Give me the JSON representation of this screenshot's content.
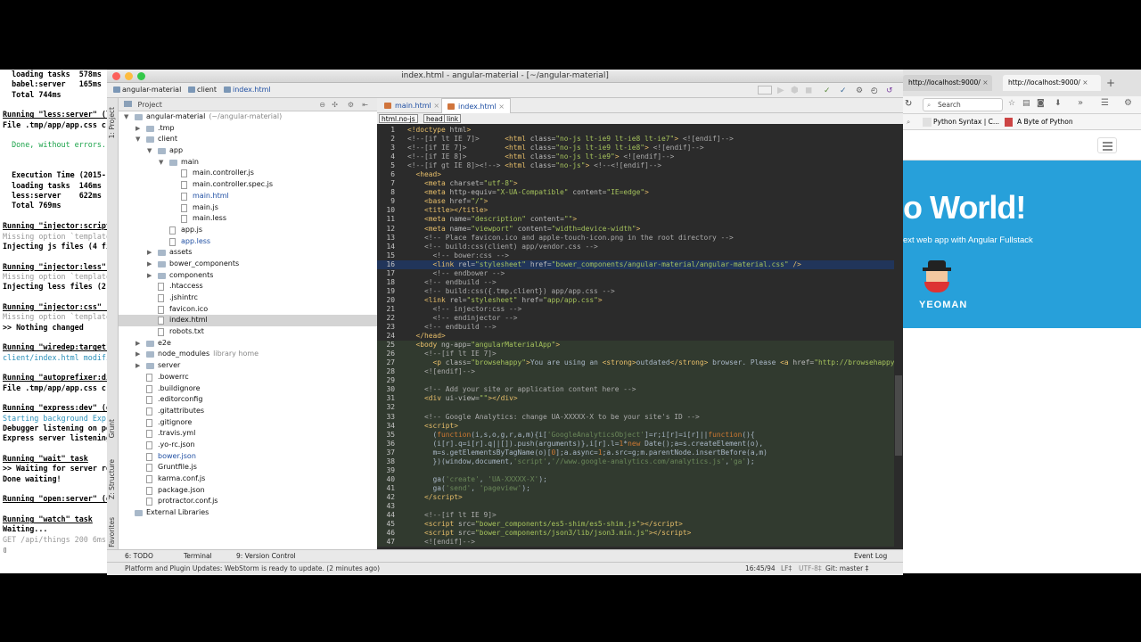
{
  "terminal": {
    "lines": [
      {
        "t": "  loading tasks  578ms",
        "c": "t-b"
      },
      {
        "t": "  babel:server   165ms",
        "c": "t-b"
      },
      {
        "t": "  Total 744ms",
        "c": "t-b"
      },
      {
        "t": "",
        "c": ""
      },
      {
        "t": "Running \"less:server\" (less) task",
        "c": "t-u"
      },
      {
        "t": "File .tmp/app/app.css created.",
        "c": "t-b"
      },
      {
        "t": "",
        "c": ""
      },
      {
        "t": "  Done, without errors.",
        "c": "t-g"
      },
      {
        "t": "",
        "c": ""
      },
      {
        "t": "",
        "c": ""
      },
      {
        "t": "  Execution Time (2015-",
        "c": "t-b"
      },
      {
        "t": "  loading tasks  146ms",
        "c": "t-b"
      },
      {
        "t": "  less:server    622ms",
        "c": "t-b"
      },
      {
        "t": "  Total 769ms",
        "c": "t-b"
      },
      {
        "t": "",
        "c": ""
      },
      {
        "t": "Running \"injector:scripts\"",
        "c": "t-u"
      },
      {
        "t": "Missing option `template`",
        "c": "t-gr"
      },
      {
        "t": "Injecting js files (4 fil",
        "c": "t-b"
      },
      {
        "t": "",
        "c": ""
      },
      {
        "t": "Running \"injector:less\" (",
        "c": "t-u"
      },
      {
        "t": "Missing option `template`",
        "c": "t-gr"
      },
      {
        "t": "Injecting less files (2 f",
        "c": "t-b"
      },
      {
        "t": "",
        "c": ""
      },
      {
        "t": "Running \"injector:css\" (i",
        "c": "t-u"
      },
      {
        "t": "Missing option `template`",
        "c": "t-gr"
      },
      {
        "t": ">> Nothing changed",
        "c": "t-b"
      },
      {
        "t": "",
        "c": ""
      },
      {
        "t": "Running \"wiredep:target\" (",
        "c": "t-u"
      },
      {
        "t": "client/index.html modified",
        "c": "t-c"
      },
      {
        "t": "",
        "c": ""
      },
      {
        "t": "Running \"autoprefixer:dist",
        "c": "t-u"
      },
      {
        "t": "File .tmp/app/app.css crea",
        "c": "t-b"
      },
      {
        "t": "",
        "c": ""
      },
      {
        "t": "Running \"express:dev\" (ex",
        "c": "t-u"
      },
      {
        "t": "Starting background Expres",
        "c": "t-c"
      },
      {
        "t": "Debugger listening on port",
        "c": "t-b"
      },
      {
        "t": "Express server listening o",
        "c": "t-b"
      },
      {
        "t": "",
        "c": ""
      },
      {
        "t": "Running \"wait\" task",
        "c": "t-u"
      },
      {
        "t": ">> Waiting for server rel",
        "c": "t-b"
      },
      {
        "t": "Done waiting!",
        "c": "t-b"
      },
      {
        "t": "",
        "c": ""
      },
      {
        "t": "Running \"open:server\" (op",
        "c": "t-u"
      },
      {
        "t": "",
        "c": ""
      },
      {
        "t": "Running \"watch\" task",
        "c": "t-u"
      },
      {
        "t": "Waiting...",
        "c": "t-b"
      },
      {
        "t": "GET /api/things 200 6ms -",
        "c": "t-gr"
      },
      {
        "t": "▯",
        "c": ""
      }
    ]
  },
  "ide": {
    "title": "index.html - angular-material - [~/angular-material]",
    "breadcrumb": [
      "angular-material",
      "client",
      "index.html"
    ],
    "project_label": "Project",
    "side_labels": {
      "project": "1: Project",
      "grunt": "Grunt",
      "structure": "Z: Structure",
      "favorites": "2: Favorites"
    },
    "tree": [
      {
        "name": "angular-material",
        "extra": "(~/angular-material)",
        "d": 0,
        "k": "folder",
        "open": true
      },
      {
        "name": ".tmp",
        "d": 1,
        "k": "folder",
        "open": false
      },
      {
        "name": "client",
        "d": 1,
        "k": "folder",
        "open": true
      },
      {
        "name": "app",
        "d": 2,
        "k": "folder",
        "open": true
      },
      {
        "name": "main",
        "d": 3,
        "k": "folder",
        "open": true
      },
      {
        "name": "main.controller.js",
        "d": 4,
        "k": "file"
      },
      {
        "name": "main.controller.spec.js",
        "d": 4,
        "k": "file"
      },
      {
        "name": "main.html",
        "d": 4,
        "k": "file",
        "blue": true
      },
      {
        "name": "main.js",
        "d": 4,
        "k": "file"
      },
      {
        "name": "main.less",
        "d": 4,
        "k": "file"
      },
      {
        "name": "app.js",
        "d": 3,
        "k": "file"
      },
      {
        "name": "app.less",
        "d": 3,
        "k": "file",
        "blue": true
      },
      {
        "name": "assets",
        "d": 2,
        "k": "folder",
        "closed": true
      },
      {
        "name": "bower_components",
        "d": 2,
        "k": "folder",
        "closed": true
      },
      {
        "name": "components",
        "d": 2,
        "k": "folder",
        "closed": true
      },
      {
        "name": ".htaccess",
        "d": 2,
        "k": "file"
      },
      {
        "name": ".jshintrc",
        "d": 2,
        "k": "file"
      },
      {
        "name": "favicon.ico",
        "d": 2,
        "k": "file"
      },
      {
        "name": "index.html",
        "d": 2,
        "k": "file",
        "sel": true
      },
      {
        "name": "robots.txt",
        "d": 2,
        "k": "file"
      },
      {
        "name": "e2e",
        "d": 1,
        "k": "folder",
        "closed": true
      },
      {
        "name": "node_modules",
        "extra": "library home",
        "d": 1,
        "k": "folder",
        "closed": true
      },
      {
        "name": "server",
        "d": 1,
        "k": "folder",
        "closed": true
      },
      {
        "name": ".bowerrc",
        "d": 1,
        "k": "file"
      },
      {
        "name": ".buildignore",
        "d": 1,
        "k": "file"
      },
      {
        "name": ".editorconfig",
        "d": 1,
        "k": "file"
      },
      {
        "name": ".gitattributes",
        "d": 1,
        "k": "file"
      },
      {
        "name": ".gitignore",
        "d": 1,
        "k": "file"
      },
      {
        "name": ".travis.yml",
        "d": 1,
        "k": "file"
      },
      {
        "name": ".yo-rc.json",
        "d": 1,
        "k": "file"
      },
      {
        "name": "bower.json",
        "d": 1,
        "k": "file",
        "blue": true
      },
      {
        "name": "Gruntfile.js",
        "d": 1,
        "k": "file"
      },
      {
        "name": "karma.conf.js",
        "d": 1,
        "k": "file"
      },
      {
        "name": "package.json",
        "d": 1,
        "k": "file"
      },
      {
        "name": "protractor.conf.js",
        "d": 1,
        "k": "file"
      },
      {
        "name": "External Libraries",
        "d": 0,
        "k": "lib"
      }
    ],
    "tabs": [
      {
        "label": "main.html",
        "active": false
      },
      {
        "label": "index.html",
        "active": true
      }
    ],
    "editor_crumbs": [
      "html.no-js",
      "head",
      "link"
    ],
    "code": [
      {
        "n": 1,
        "h": "<span class='tg'>&lt;!doctype </span><span class='at'>html</span><span class='tg'>&gt;</span>"
      },
      {
        "n": 2,
        "h": "<span class='cm'>&lt;!--[if lt IE 7]&gt;      </span><span class='tg'>&lt;html </span><span class='at'>class=</span><span class='av'>\"no-js lt-ie9 lt-ie8 lt-ie7\"</span><span class='tg'>&gt;</span><span class='cm'> &lt;![endif]--&gt;</span>"
      },
      {
        "n": 3,
        "h": "<span class='cm'>&lt;!--[if IE 7]&gt;         </span><span class='tg'>&lt;html </span><span class='at'>class=</span><span class='av'>\"no-js lt-ie9 lt-ie8\"</span><span class='tg'>&gt;</span><span class='cm'> &lt;![endif]--&gt;</span>"
      },
      {
        "n": 4,
        "h": "<span class='cm'>&lt;!--[if IE 8]&gt;         </span><span class='tg'>&lt;html </span><span class='at'>class=</span><span class='av'>\"no-js lt-ie9\"</span><span class='tg'>&gt;</span><span class='cm'> &lt;![endif]--&gt;</span>"
      },
      {
        "n": 5,
        "h": "<span class='cm'>&lt;!--[if gt IE 8]&gt;&lt;!--&gt; </span><span class='tg'>&lt;html </span><span class='at'>class=</span><span class='av'>\"no-js\"</span><span class='tg'>&gt;</span><span class='cm'> &lt;!--&lt;![endif]--&gt;</span>"
      },
      {
        "n": 6,
        "h": "  <span class='tg'>&lt;head&gt;</span>"
      },
      {
        "n": 7,
        "h": "    <span class='tg'>&lt;meta </span><span class='at'>charset=</span><span class='av'>\"utf-8\"</span><span class='tg'>&gt;</span>"
      },
      {
        "n": 8,
        "h": "    <span class='tg'>&lt;meta </span><span class='at'>http-equiv=</span><span class='av'>\"X-UA-Compatible\"</span><span class='at'> content=</span><span class='av'>\"IE=edge\"</span><span class='tg'>&gt;</span>"
      },
      {
        "n": 9,
        "h": "    <span class='tg'>&lt;base </span><span class='at'>href=</span><span class='av'>\"/\"</span><span class='tg'>&gt;</span>"
      },
      {
        "n": 10,
        "h": "    <span class='tg'>&lt;title&gt;&lt;/title&gt;</span>"
      },
      {
        "n": 11,
        "h": "    <span class='tg'>&lt;meta </span><span class='at'>name=</span><span class='av'>\"description\"</span><span class='at'> content=</span><span class='av'>\"\"</span><span class='tg'>&gt;</span>"
      },
      {
        "n": 12,
        "h": "    <span class='tg'>&lt;meta </span><span class='at'>name=</span><span class='av'>\"viewport\"</span><span class='at'> content=</span><span class='av'>\"width=device-width\"</span><span class='tg'>&gt;</span>"
      },
      {
        "n": 13,
        "h": "    <span class='cm'>&lt;!-- Place favicon.ico and apple-touch-icon.png in the root directory --&gt;</span>"
      },
      {
        "n": 14,
        "h": "    <span class='cm'>&lt;!-- build:css(client) app/vendor.css --&gt;</span>"
      },
      {
        "n": 15,
        "h": "      <span class='cm'>&lt;!-- bower:css --&gt;</span>"
      },
      {
        "n": 16,
        "h": "      <span class='tg'>&lt;link </span><span class='at'>rel=</span><span class='av'>\"stylesheet\"</span><span class='at'> href=</span><span class='av'>\"bower_components/angular-material/angular-material.css\"</span><span class='tg'> /&gt;</span>",
        "hl": true
      },
      {
        "n": 17,
        "h": "      <span class='cm'>&lt;!-- endbower --&gt;</span>"
      },
      {
        "n": 18,
        "h": "    <span class='cm'>&lt;!-- endbuild --&gt;</span>"
      },
      {
        "n": 19,
        "h": "    <span class='cm'>&lt;!-- build:css({.tmp,client}) app/app.css --&gt;</span>"
      },
      {
        "n": 20,
        "h": "    <span class='tg'>&lt;link </span><span class='at'>rel=</span><span class='av'>\"stylesheet\"</span><span class='at'> href=</span><span class='av'>\"app/app.css\"</span><span class='tg'>&gt;</span>"
      },
      {
        "n": 21,
        "h": "      <span class='cm'>&lt;!-- injector:css --&gt;</span>"
      },
      {
        "n": 22,
        "h": "      <span class='cm'>&lt;!-- endinjector --&gt;</span>"
      },
      {
        "n": 23,
        "h": "    <span class='cm'>&lt;!-- endbuild --&gt;</span>"
      },
      {
        "n": 24,
        "h": "  <span class='tg'>&lt;/head&gt;</span>"
      },
      {
        "n": 25,
        "h": "  <span class='tg'>&lt;body </span><span class='at'>ng-app=</span><span class='av'>\"angularMaterialApp\"</span><span class='tg'>&gt;</span>",
        "jsb": true
      },
      {
        "n": 26,
        "h": "    <span class='cm'>&lt;!--[if lt IE 7]&gt;</span>",
        "jsb": true
      },
      {
        "n": 27,
        "h": "      <span class='tg'>&lt;p </span><span class='at'>class=</span><span class='av'>\"browsehappy\"</span><span class='tg'>&gt;</span>You are using an <span class='tg'>&lt;strong&gt;</span>outdated<span class='tg'>&lt;/strong&gt;</span> browser. Please <span class='tg'>&lt;a </span><span class='at'>href=</span><span class='av'>\"http://browsehappy.com</span>",
        "jsb": true
      },
      {
        "n": 28,
        "h": "    <span class='cm'>&lt;![endif]--&gt;</span>",
        "jsb": true
      },
      {
        "n": 29,
        "h": "",
        "jsb": true
      },
      {
        "n": 30,
        "h": "    <span class='cm'>&lt;!-- Add your site or application content here --&gt;</span>",
        "jsb": true
      },
      {
        "n": 31,
        "h": "    <span class='tg'>&lt;div </span><span class='at'>ui-view=</span><span class='av'>\"\"</span><span class='tg'>&gt;&lt;/div&gt;</span>",
        "jsb": true
      },
      {
        "n": 32,
        "h": "",
        "jsb": true
      },
      {
        "n": 33,
        "h": "    <span class='cm'>&lt;!-- Google Analytics: change UA-XXXXX-X to be your site's ID --&gt;</span>",
        "jsb": true
      },
      {
        "n": 34,
        "h": "    <span class='tg'>&lt;script&gt;</span>",
        "jsb": true
      },
      {
        "n": 35,
        "h": "      (<span class='kw'>function</span>(i,s,o,g,r,a,m){i[<span class='st'>'GoogleAnalyticsObject'</span>]=r;i[r]=i[r]||<span class='kw'>function</span>(){",
        "jsb": true
      },
      {
        "n": 36,
        "h": "      (i[r].q=i[r].q||[]).push(arguments)},i[r].l=<span class='kw'>1</span>*<span class='kw'>new</span> Date();a=s.createElement(o),",
        "jsb": true
      },
      {
        "n": 37,
        "h": "      m=s.getElementsByTagName(o)[<span class='kw'>0</span>];a.async=<span class='kw'>1</span>;a.src=g;m.parentNode.insertBefore(a,m)",
        "jsb": true
      },
      {
        "n": 38,
        "h": "      })(window,document,<span class='st'>'script'</span>,<span class='st'>'//www.google-analytics.com/analytics.js'</span>,<span class='st'>'ga'</span>);",
        "jsb": true
      },
      {
        "n": 39,
        "h": "",
        "jsb": true
      },
      {
        "n": 40,
        "h": "      ga(<span class='st'>'create'</span>, <span class='st'>'UA-XXXXX-X'</span>);",
        "jsb": true
      },
      {
        "n": 41,
        "h": "      ga(<span class='st'>'send'</span>, <span class='st'>'pageview'</span>);",
        "jsb": true
      },
      {
        "n": 42,
        "h": "    <span class='tg'>&lt;/script&gt;</span>",
        "jsb": true
      },
      {
        "n": 43,
        "h": "",
        "jsb": true
      },
      {
        "n": 44,
        "h": "    <span class='cm'>&lt;!--[if lt IE 9]&gt;</span>",
        "jsb": true
      },
      {
        "n": 45,
        "h": "    <span class='tg'>&lt;script </span><span class='at'>src=</span><span class='av'>\"bower_components/es5-shim/es5-shim.js\"</span><span class='tg'>&gt;&lt;/script&gt;</span>",
        "jsb": true
      },
      {
        "n": 46,
        "h": "    <span class='tg'>&lt;script </span><span class='at'>src=</span><span class='av'>\"bower_components/json3/lib/json3.min.js\"</span><span class='tg'>&gt;&lt;/script&gt;</span>",
        "jsb": true
      },
      {
        "n": 47,
        "h": "    <span class='cm'>&lt;![endif]--&gt;</span>",
        "jsb": true
      }
    ],
    "bottom_tools": {
      "todo": "6: TODO",
      "terminal": "Terminal",
      "vcs": "9: Version Control",
      "event_log": "Event Log"
    },
    "status": {
      "message": "Platform and Plugin Updates: WebStorm is ready to update. (2 minutes ago)",
      "position": "16:45/94",
      "line_sep": "LF‡",
      "encoding": "UTF-8‡",
      "git": "Git: master ‡"
    }
  },
  "browser": {
    "tabs": [
      "http://localhost:9000/",
      "http://localhost:9000/"
    ],
    "search_placeholder": "Search",
    "bookmarks": [
      "Python Syntax | C...",
      "A Byte of Python"
    ],
    "hero_title": "o World!",
    "hero_sub": "ext web app with Angular Fullstack",
    "logo_text": "YEOMAN"
  }
}
